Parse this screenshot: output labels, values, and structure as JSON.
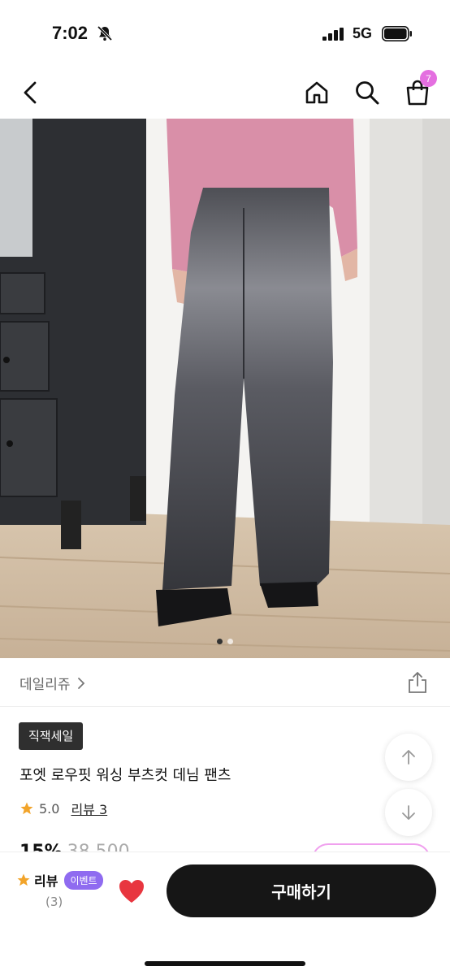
{
  "status_bar": {
    "time": "7:02",
    "network": "5G"
  },
  "nav": {
    "cart_count": "7"
  },
  "gallery": {
    "page_count": 2,
    "current_page": 1
  },
  "brand": {
    "name": "데일리쥬"
  },
  "product": {
    "badge": "직잭세일",
    "title": "포엣 로우핏 워싱 부츠컷 데님 팬츠",
    "rating": "5.0",
    "review_link": "리뷰 3",
    "discount": "15%",
    "original_price": "38,500"
  },
  "bottom_bar": {
    "review_label": "리뷰",
    "event_label": "이벤트",
    "review_count": "(3)",
    "buy_label": "구매하기"
  },
  "colors": {
    "accent_pink": "#e46fe0",
    "event_purple": "#8f6bf0",
    "heart_red": "#e8363f",
    "star": "#f2a42a"
  }
}
